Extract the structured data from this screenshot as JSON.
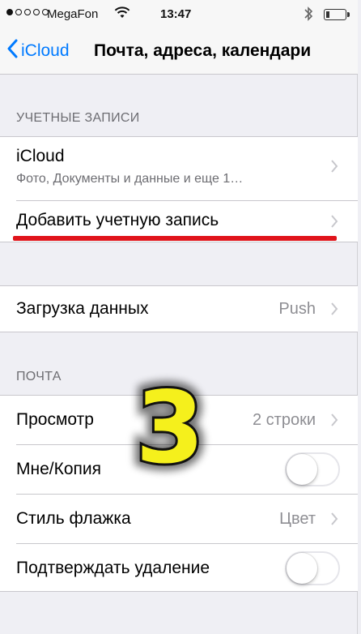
{
  "status_bar": {
    "carrier": "MegaFon",
    "time": "13:47",
    "signal_dots_filled": 1,
    "signal_dots_total": 5,
    "battery_level": 0.1
  },
  "nav": {
    "back_label": "iCloud",
    "title": "Почта, адреса, календари"
  },
  "accounts": {
    "header": "УЧЕТНЫЕ ЗАПИСИ",
    "icloud": {
      "label": "iCloud",
      "subtitle": "Фото, Документы и данные и еще 1…"
    },
    "add_account": "Добавить учетную запись"
  },
  "fetch": {
    "label": "Загрузка данных",
    "value": "Push"
  },
  "mail": {
    "header": "ПОЧТА",
    "preview": {
      "label": "Просмотр",
      "value": "2 строки"
    },
    "show_cc": {
      "label": "Мне/Копия",
      "enabled": false
    },
    "flag_style": {
      "label": "Стиль флажка",
      "value": "Цвет"
    },
    "ask_before_delete": {
      "label": "Подтверждать удаление",
      "enabled": false
    }
  },
  "annotation": {
    "step_number": "3",
    "colors": {
      "fill": "#f5f01c",
      "stroke": "#111111",
      "highlight": "#e0141b"
    }
  },
  "colors": {
    "accent": "#007aff",
    "background": "#efeff4",
    "secondary_text": "#6d6d72",
    "value_text": "#8e8e93"
  }
}
